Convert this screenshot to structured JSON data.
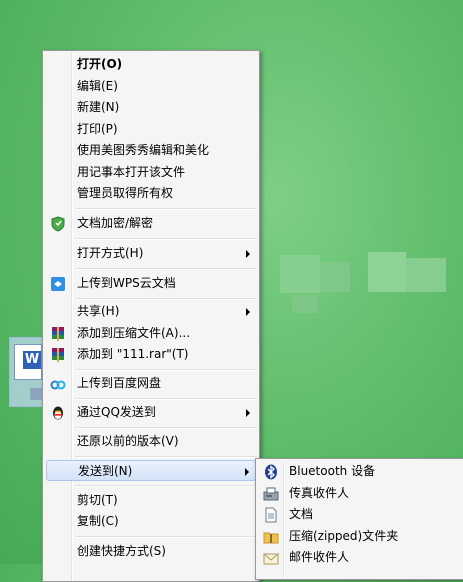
{
  "context_menu": {
    "items": [
      {
        "label": "打开(O)",
        "bold": true
      },
      {
        "label": "编辑(E)"
      },
      {
        "label": "新建(N)"
      },
      {
        "label": "打印(P)"
      },
      {
        "label": "使用美图秀秀编辑和美化"
      },
      {
        "label": "用记事本打开该文件"
      },
      {
        "label": "管理员取得所有权"
      },
      {
        "label": "文档加密/解密",
        "icon": "shield-icon"
      },
      {
        "label": "打开方式(H)",
        "submenu": true
      },
      {
        "label": "上传到WPS云文档",
        "icon": "wps-cloud-icon"
      },
      {
        "label": "共享(H)",
        "submenu": true
      },
      {
        "label": "添加到压缩文件(A)...",
        "icon": "winrar-icon"
      },
      {
        "label": "添加到 \"111.rar\"(T)",
        "icon": "winrar-icon"
      },
      {
        "label": "上传到百度网盘",
        "icon": "baidu-cloud-icon"
      },
      {
        "label": "通过QQ发送到",
        "icon": "qq-penguin-icon",
        "submenu": true
      },
      {
        "label": "还原以前的版本(V)"
      },
      {
        "label": "发送到(N)",
        "submenu": true,
        "highlighted": true
      },
      {
        "label": "剪切(T)"
      },
      {
        "label": "复制(C)"
      },
      {
        "label": "创建快捷方式(S)"
      }
    ]
  },
  "send_to_menu": {
    "items": [
      {
        "label": "Bluetooth 设备",
        "icon": "bluetooth-icon"
      },
      {
        "label": "传真收件人",
        "icon": "fax-icon"
      },
      {
        "label": "文档",
        "icon": "documents-icon"
      },
      {
        "label": "压缩(zipped)文件夹",
        "icon": "zip-folder-icon"
      },
      {
        "label": "邮件收件人",
        "icon": "mail-icon"
      }
    ]
  },
  "desktop_icon": {
    "letter": "W",
    "icon": "word-document-icon"
  },
  "colors": {
    "menu_bg": "#f5f5f5",
    "highlight": "#d3e3f8",
    "desktop": "#5fbd6b"
  }
}
